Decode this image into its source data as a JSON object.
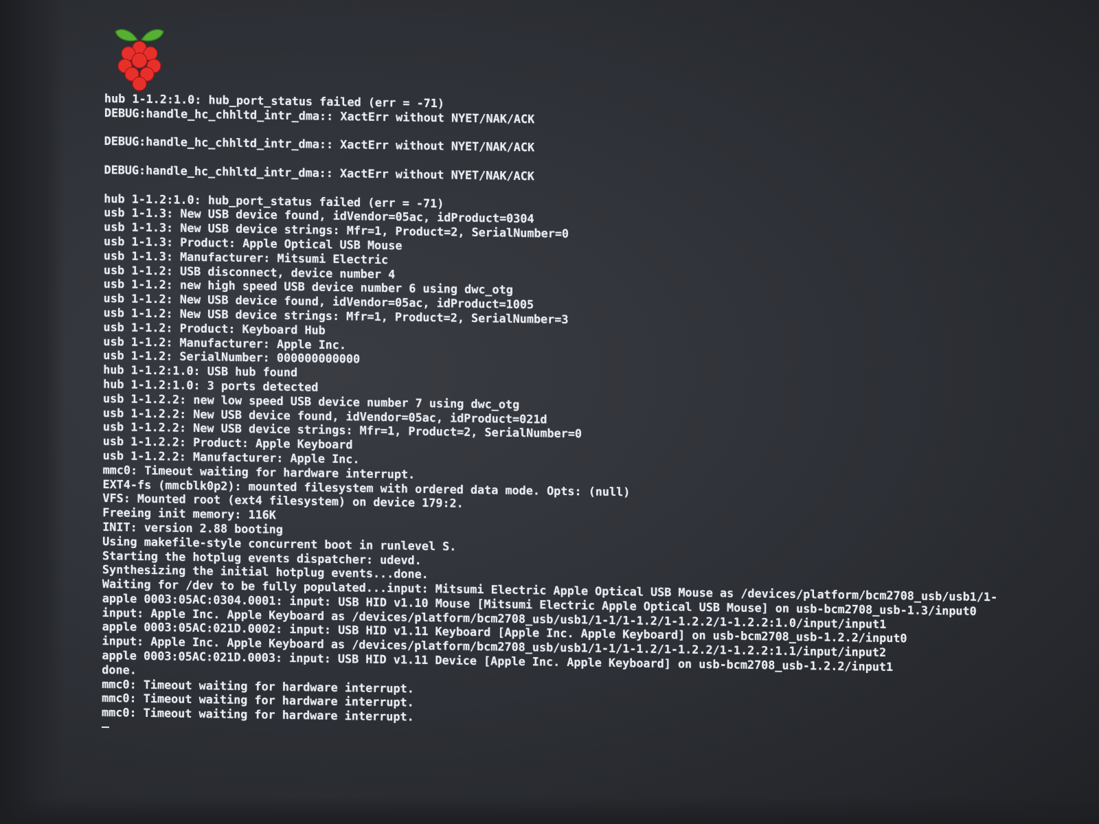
{
  "console": {
    "lines": [
      "hub 1-1.2:1.0: hub_port_status failed (err = -71)",
      "DEBUG:handle_hc_chhltd_intr_dma:: XactErr without NYET/NAK/ACK",
      "",
      "DEBUG:handle_hc_chhltd_intr_dma:: XactErr without NYET/NAK/ACK",
      "",
      "DEBUG:handle_hc_chhltd_intr_dma:: XactErr without NYET/NAK/ACK",
      "",
      "hub 1-1.2:1.0: hub_port_status failed (err = -71)",
      "usb 1-1.3: New USB device found, idVendor=05ac, idProduct=0304",
      "usb 1-1.3: New USB device strings: Mfr=1, Product=2, SerialNumber=0",
      "usb 1-1.3: Product: Apple Optical USB Mouse",
      "usb 1-1.3: Manufacturer: Mitsumi Electric",
      "usb 1-1.2: USB disconnect, device number 4",
      "usb 1-1.2: new high speed USB device number 6 using dwc_otg",
      "usb 1-1.2: New USB device found, idVendor=05ac, idProduct=1005",
      "usb 1-1.2: New USB device strings: Mfr=1, Product=2, SerialNumber=3",
      "usb 1-1.2: Product: Keyboard Hub",
      "usb 1-1.2: Manufacturer: Apple Inc.",
      "usb 1-1.2: SerialNumber: 000000000000",
      "hub 1-1.2:1.0: USB hub found",
      "hub 1-1.2:1.0: 3 ports detected",
      "usb 1-1.2.2: new low speed USB device number 7 using dwc_otg",
      "usb 1-1.2.2: New USB device found, idVendor=05ac, idProduct=021d",
      "usb 1-1.2.2: New USB device strings: Mfr=1, Product=2, SerialNumber=0",
      "usb 1-1.2.2: Product: Apple Keyboard",
      "usb 1-1.2.2: Manufacturer: Apple Inc.",
      "mmc0: Timeout waiting for hardware interrupt.",
      "EXT4-fs (mmcblk0p2): mounted filesystem with ordered data mode. Opts: (null)",
      "VFS: Mounted root (ext4 filesystem) on device 179:2.",
      "Freeing init memory: 116K",
      "INIT: version 2.88 booting",
      "Using makefile-style concurrent boot in runlevel S.",
      "Starting the hotplug events dispatcher: udevd.",
      "Synthesizing the initial hotplug events...done.",
      "Waiting for /dev to be fully populated...input: Mitsumi Electric Apple Optical USB Mouse as /devices/platform/bcm2708_usb/usb1/1-",
      "apple 0003:05AC:0304.0001: input: USB HID v1.10 Mouse [Mitsumi Electric Apple Optical USB Mouse] on usb-bcm2708_usb-1.3/input0",
      "input: Apple Inc. Apple Keyboard as /devices/platform/bcm2708_usb/usb1/1-1/1-1.2/1-1.2.2/1-1.2.2:1.0/input/input1",
      "apple 0003:05AC:021D.0002: input: USB HID v1.11 Keyboard [Apple Inc. Apple Keyboard] on usb-bcm2708_usb-1.2.2/input0",
      "input: Apple Inc. Apple Keyboard as /devices/platform/bcm2708_usb/usb1/1-1/1-1.2/1-1.2.2/1-1.2.2:1.1/input/input2",
      "apple 0003:05AC:021D.0003: input: USB HID v1.11 Device [Apple Inc. Apple Keyboard] on usb-bcm2708_usb-1.2.2/input1",
      "done.",
      "mmc0: Timeout waiting for hardware interrupt.",
      "mmc0: Timeout waiting for hardware interrupt.",
      "mmc0: Timeout waiting for hardware interrupt."
    ]
  },
  "colors": {
    "text": "#e8ecf2",
    "background": "#2f3238",
    "logo_berry": "#e8302b",
    "logo_leaf": "#57b035"
  },
  "icons": {
    "logo": "raspberry-pi-logo-icon",
    "cursor": "text-cursor-icon"
  }
}
